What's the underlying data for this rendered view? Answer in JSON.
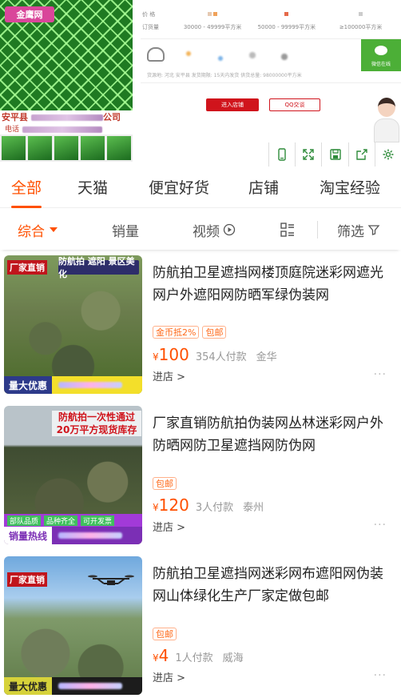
{
  "banner": {
    "brand": "金鹰网",
    "company_name": "安平县",
    "company_suffix": "公司",
    "phone_label": "电话",
    "price_table": {
      "row1_label": "价 格",
      "row2_label": "订货量",
      "tiers": [
        "30000 - 49999平方米",
        "50000 - 99999平方米",
        "≥100000平方米"
      ]
    },
    "wechat": "微信在线",
    "contact_meta": "货源地: 河北 安平县   发货期限: 15天内发货   供货总量: 98000000平方米",
    "enter_shop": "进入店铺",
    "qq": "QQ交谈"
  },
  "tabs": [
    "全部",
    "天猫",
    "便宜好货",
    "店铺",
    "淘宝经验"
  ],
  "sortbar": {
    "default": "综合",
    "sales": "销量",
    "video": "视频",
    "filter": "筛选"
  },
  "products": [
    {
      "title": "防航拍卫星遮挡网楼顶庭院迷彩网遮光网户外遮阳网防晒军绿伪装网",
      "badges": [
        "金币抵2%",
        "包邮"
      ],
      "currency": "¥",
      "price": "100",
      "sold": "354人付款",
      "location": "金华",
      "shop": "进店 >",
      "img_tag": "厂家直销",
      "img_title": "防航拍 遮阳 景区美化",
      "img_bottom": "量大优惠"
    },
    {
      "title": "厂家直销防航拍伪装网丛林迷彩网户外防晒网防卫星遮挡网防伪网",
      "badges": [
        "包邮"
      ],
      "currency": "¥",
      "price": "120",
      "sold": "3人付款",
      "location": "泰州",
      "shop": "进店 >",
      "img_headline": "防航拍一次性通过\n20万平方现货库存",
      "img_band": [
        "部队品质",
        "品种齐全",
        "可开发票"
      ],
      "img_bottom": "销量热线"
    },
    {
      "title": "防航拍卫星遮挡网迷彩网布遮阳网伪装网山体绿化生产厂家定做包邮",
      "badges": [
        "包邮"
      ],
      "currency": "¥",
      "price": "4",
      "sold": "1人付款",
      "location": "威海",
      "shop": "进店 >",
      "img_tag": "厂家直销",
      "img_bottom": "量大优惠"
    }
  ],
  "more_icon": "more-dots-icon"
}
